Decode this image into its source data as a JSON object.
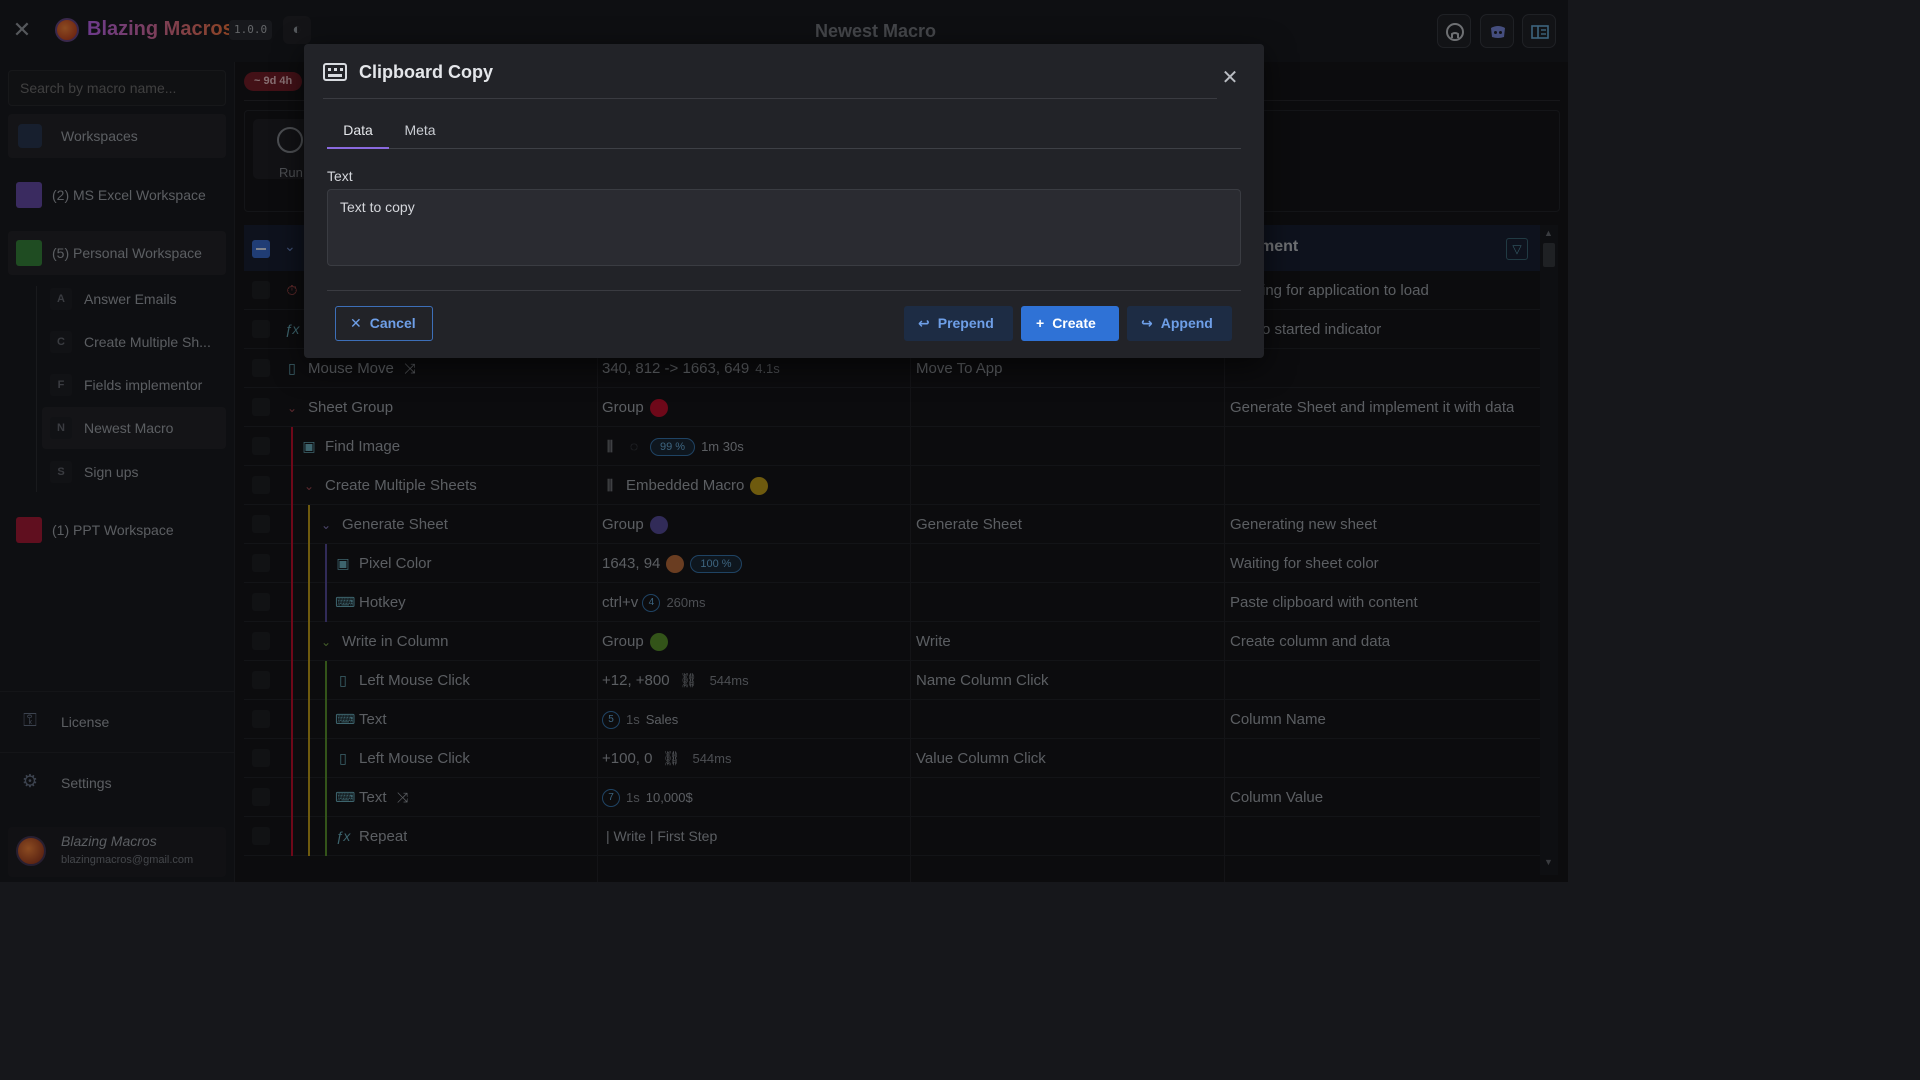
{
  "app": {
    "name": "Blazing Macros",
    "version": "1.0.0",
    "page_title": "Newest Macro"
  },
  "sidebar": {
    "search_placeholder": "Search by macro name...",
    "workspaces_label": "Workspaces",
    "workspaces": [
      {
        "label": "(2) MS Excel Workspace",
        "color": "#6a4fb0"
      },
      {
        "label": "(5) Personal Workspace",
        "color": "#3a8a3e"
      },
      {
        "label": "(1) PPT Workspace",
        "color": "#b01c3a"
      }
    ],
    "macros": [
      {
        "letter": "A",
        "label": "Answer Emails"
      },
      {
        "letter": "C",
        "label": "Create Multiple Sh..."
      },
      {
        "letter": "F",
        "label": "Fields implementor"
      },
      {
        "letter": "N",
        "label": "Newest Macro"
      },
      {
        "letter": "S",
        "label": "Sign ups"
      }
    ],
    "license_label": "License",
    "settings_label": "Settings",
    "user": {
      "name": "Blazing Macros",
      "email": "blazingmacros@gmail.com"
    }
  },
  "main": {
    "tag": "~ 9d 4h",
    "run_label": "Run",
    "header_comment": "ment",
    "rows": [
      {
        "name": "",
        "icon": "timer-icon",
        "value": "",
        "desc": "",
        "comment": "ing for application to load"
      },
      {
        "name": "",
        "icon": "fx-icon",
        "value": "",
        "desc": "",
        "comment": "o started indicator"
      },
      {
        "name": "Mouse Move",
        "icon": "mouse-icon",
        "value": "340, 812 -> 1663, 649",
        "extra": "4.1s",
        "desc": "Move To App",
        "comment": ""
      },
      {
        "name": "Sheet Group",
        "value": "Group",
        "desc": "",
        "comment": "Generate Sheet and implement it with data"
      },
      {
        "name": "Find Image",
        "icon": "image-icon",
        "pill": "99 %",
        "extra": "1m 30s",
        "desc": "",
        "comment": ""
      },
      {
        "name": "Create Multiple Sheets",
        "value": "Embedded Macro",
        "desc": "",
        "comment": ""
      },
      {
        "name": "Generate Sheet",
        "value": "Group",
        "desc": "Generate Sheet",
        "comment": "Generating new sheet"
      },
      {
        "name": "Pixel Color",
        "icon": "image-icon",
        "value": "1643, 94",
        "pill": "100 %",
        "desc": "",
        "comment": "Waiting for sheet color"
      },
      {
        "name": "Hotkey",
        "icon": "keyboard-icon",
        "value": "ctrl+v",
        "num": "4",
        "extra": "260ms",
        "desc": "",
        "comment": "Paste clipboard with content"
      },
      {
        "name": "Write in Column",
        "value": "Group",
        "desc": "Write",
        "comment": "Create column and data"
      },
      {
        "name": "Left Mouse Click",
        "icon": "mouse-icon",
        "value": "+12, +800",
        "extra": "544ms",
        "desc": "Name Column Click",
        "comment": ""
      },
      {
        "name": "Text",
        "icon": "keyboard-icon",
        "num": "5",
        "extra": "1s",
        "value": "Sales",
        "desc": "",
        "comment": "Column Name"
      },
      {
        "name": "Left Mouse Click",
        "icon": "mouse-icon",
        "value": "+100, 0",
        "extra": "544ms",
        "desc": "Value Column Click",
        "comment": ""
      },
      {
        "name": "Text",
        "icon": "keyboard-icon",
        "num": "7",
        "extra": "1s",
        "value": "10,000$",
        "desc": "",
        "comment": "Column Value"
      },
      {
        "name": "Repeat",
        "icon": "fx-icon",
        "value": "| Write | First Step",
        "desc": "",
        "comment": ""
      }
    ]
  },
  "modal": {
    "title": "Clipboard Copy",
    "tabs": [
      "Data",
      "Meta"
    ],
    "text_label": "Text",
    "text_value": "Text to copy",
    "cancel_label": "Cancel",
    "prepend_label": "Prepend",
    "create_label": "Create",
    "append_label": "Append"
  },
  "colors": {
    "accent": "#2f72d6",
    "tab_active": "#8a6adf",
    "group_red": "#c8102e",
    "group_yellow": "#c9a41a",
    "group_purple": "#5a4fa0",
    "group_green": "#5e9a2e",
    "pixel_color": "#c2703d"
  }
}
